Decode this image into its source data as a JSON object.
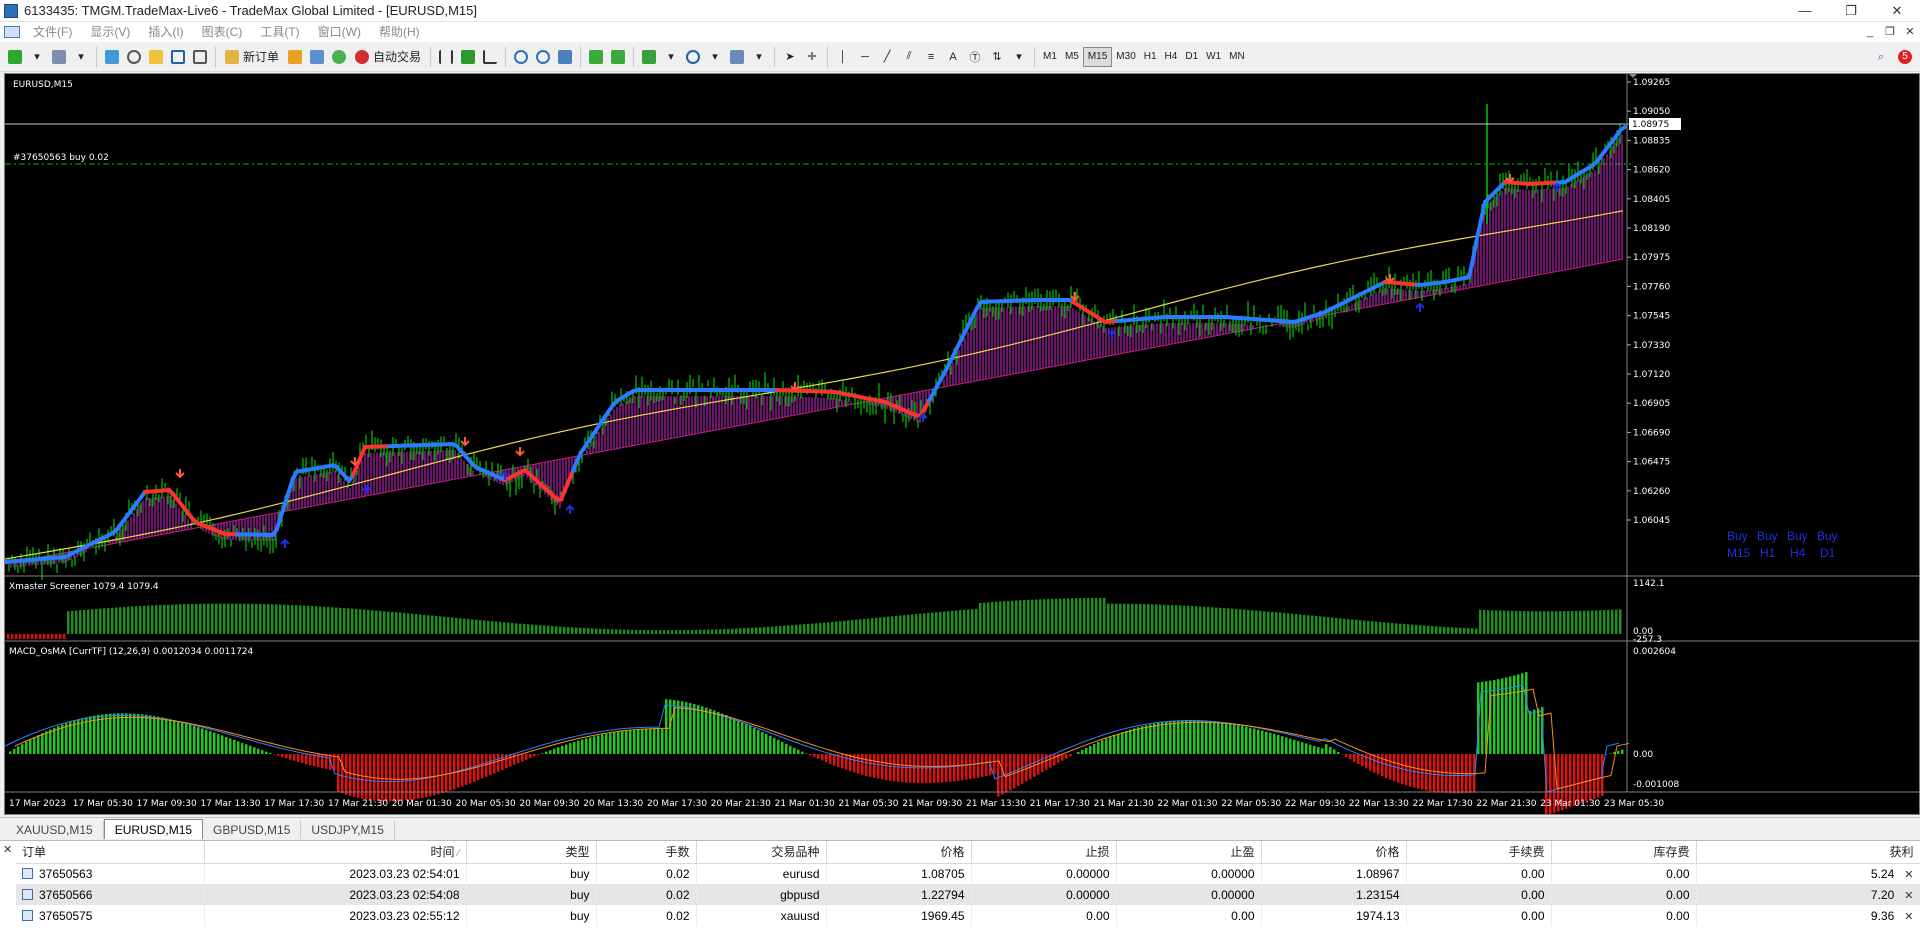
{
  "window": {
    "title": "6133435: TMGM.TradeMax-Live6 - TradeMax Global Limited - [EURUSD,M15]",
    "controls": [
      "—",
      "❐",
      "✕"
    ]
  },
  "menu": {
    "items": [
      "文件(F)",
      "显示(V)",
      "插入(I)",
      "图表(C)",
      "工具(T)",
      "窗口(W)",
      "帮助(H)"
    ],
    "mdi_controls": [
      "_",
      "❐",
      "✕"
    ]
  },
  "toolbar": {
    "new_order": "新订单",
    "auto_trading": "自动交易",
    "text_tool": "A",
    "timeframes": [
      "M1",
      "M5",
      "M15",
      "M30",
      "H1",
      "H4",
      "D1",
      "W1",
      "MN"
    ],
    "active_timeframe": "M15",
    "notification_count": "5"
  },
  "chart": {
    "symbol_label": "EURUSD,M15",
    "order_label": "#37650563 buy 0.02",
    "current_price": "1.08975",
    "price_ticks": [
      "1.09265",
      "1.09050",
      "1.08835",
      "1.08620",
      "1.08405",
      "1.08190",
      "1.07975",
      "1.07760",
      "1.07545",
      "1.07330",
      "1.07120",
      "1.06905",
      "1.06690",
      "1.06475",
      "1.06260",
      "1.06045"
    ],
    "signal_buys": [
      "Buy",
      "Buy",
      "Buy",
      "Buy"
    ],
    "signal_tfs": [
      "M15",
      "H1",
      "H4",
      "D1"
    ],
    "ind1_label": "Xmaster Screener 1079.4 1079.4",
    "ind1_ticks": [
      "1142.1",
      "0.00",
      "-257.3"
    ],
    "ind2_label": "MACD_OsMA [CurrTF] (12,26,9) 0.0012034 0.0011724",
    "ind2_ticks": [
      "0.002604",
      "0.00",
      "-0.001008"
    ],
    "time_ticks": [
      "17 Mar 2023",
      "17 Mar 05:30",
      "17 Mar 09:30",
      "17 Mar 13:30",
      "17 Mar 17:30",
      "17 Mar 21:30",
      "20 Mar 01:30",
      "20 Mar 05:30",
      "20 Mar 09:30",
      "20 Mar 13:30",
      "20 Mar 17:30",
      "20 Mar 21:30",
      "21 Mar 01:30",
      "21 Mar 05:30",
      "21 Mar 09:30",
      "21 Mar 13:30",
      "21 Mar 17:30",
      "21 Mar 21:30",
      "22 Mar 01:30",
      "22 Mar 05:30",
      "22 Mar 09:30",
      "22 Mar 13:30",
      "22 Mar 17:30",
      "22 Mar 21:30",
      "23 Mar 01:30",
      "23 Mar 05:30"
    ],
    "colors": {
      "candle": "#00c800",
      "trend_up": "#2a7bff",
      "trend_down": "#ff3030",
      "cloud": "#8a1a8a",
      "ma": "#e8d84a",
      "bid_line": "#c8c8c8",
      "order_line": "#00c000",
      "signal_text": "#1f2fe0",
      "macd_pos": "#22c722",
      "macd_neg": "#e01010",
      "macd_line": "#2f7fff",
      "signal_line": "#ff8c1a"
    }
  },
  "chart_tabs": [
    "XAUUSD,M15",
    "EURUSD,M15",
    "GBPUSD,M15",
    "USDJPY,M15"
  ],
  "active_chart_tab": "EURUSD,M15",
  "trade_table": {
    "headers": [
      "订单",
      "时间",
      "类型",
      "手数",
      "交易品种",
      "价格",
      "止损",
      "止盈",
      "价格",
      "手续费",
      "库存费",
      "获利"
    ],
    "rows": [
      [
        "37650563",
        "2023.03.23 02:54:01",
        "buy",
        "0.02",
        "eurusd",
        "1.08705",
        "0.00000",
        "0.00000",
        "1.08967",
        "0.00",
        "0.00",
        "5.24"
      ],
      [
        "37650566",
        "2023.03.23 02:54:08",
        "buy",
        "0.02",
        "gbpusd",
        "1.22794",
        "0.00000",
        "0.00000",
        "1.23154",
        "0.00",
        "0.00",
        "7.20"
      ],
      [
        "37650575",
        "2023.03.23 02:55:12",
        "buy",
        "0.02",
        "xauusd",
        "1969.45",
        "0.00",
        "0.00",
        "1974.13",
        "0.00",
        "0.00",
        "9.36"
      ]
    ]
  }
}
